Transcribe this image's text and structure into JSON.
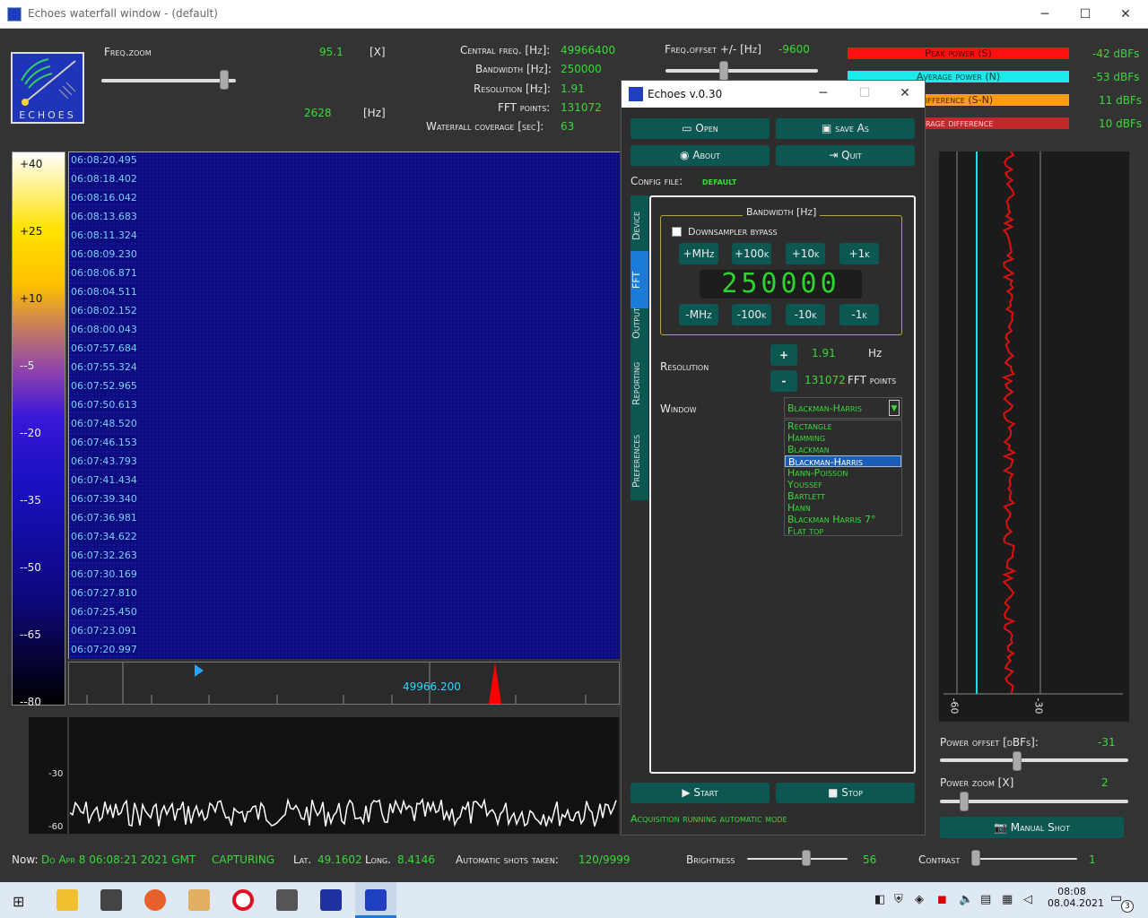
{
  "window": {
    "title": "Echoes waterfall window - (default)"
  },
  "logo": {
    "text": "ECHOES"
  },
  "top": {
    "freq_zoom_label": "Freq.zoom",
    "freq_zoom_value": "95.1",
    "freq_zoom_unit": "[X]",
    "hz_value": "2628",
    "hz_unit": "[Hz]",
    "central_freq_label": "Central freq. [Hz]:",
    "central_freq_value": "49966400",
    "bandwidth_label": "Bandwidth [Hz]:",
    "bandwidth_value": "250000",
    "resolution_label": "Resolution [Hz]:",
    "resolution_value": "1.91",
    "fft_label": "FFT points:",
    "fft_value": "131072",
    "coverage_label": "Waterfall coverage [sec]:",
    "coverage_value": "63",
    "offset_label": "Freq.offset +/- [Hz]",
    "offset_value": "-9600"
  },
  "power": {
    "peak_label": "Peak power (S)",
    "peak_value": "-42 dBFs",
    "peak_color": "#ff1010",
    "avg_label": "Average power (N)",
    "avg_value": "-53 dBFs",
    "avg_color": "#1ce9e9",
    "diff_label": "ifference (S-N)",
    "diff_value": "11 dBFs",
    "diff_color": "#ff9c16",
    "avgdiff_label": "rage difference",
    "avgdiff_value": "10 dBFs",
    "avgdiff_color": "#c0282c"
  },
  "scale": [
    "+40",
    "+25",
    "+10",
    "--5",
    "--20",
    "--35",
    "--50",
    "--65",
    "--80"
  ],
  "timestamps": [
    "06:08:20.495",
    "06:08:18.402",
    "06:08:16.042",
    "06:08:13.683",
    "06:08:11.324",
    "06:08:09.230",
    "06:08:06.871",
    "06:08:04.511",
    "06:08:02.152",
    "06:08:00.043",
    "06:07:57.684",
    "06:07:55.324",
    "06:07:52.965",
    "06:07:50.613",
    "06:07:48.520",
    "06:07:46.153",
    "06:07:43.793",
    "06:07:41.434",
    "06:07:39.340",
    "06:07:36.981",
    "06:07:34.622",
    "06:07:32.263",
    "06:07:30.169",
    "06:07:27.810",
    "06:07:25.450",
    "06:07:23.091",
    "06:07:20.997"
  ],
  "freqaxis": {
    "label": "49966.200"
  },
  "spectrum": {
    "ticks": [
      "-30",
      "-60"
    ]
  },
  "powerpanel": {
    "left_tick": "-60",
    "right_tick": "-30"
  },
  "power_offset": {
    "label": "Power offset [dBFs]:",
    "value": "-31"
  },
  "power_zoom": {
    "label": "Power zoom [X]",
    "value": "2"
  },
  "manual_shot": "Manual Shot",
  "dialog": {
    "title": "Echoes v.0.30",
    "open": "Open",
    "save_as": "save As",
    "about": "About",
    "quit": "Quit",
    "config_label": "Config file:",
    "config_value": "default",
    "tabs": [
      "Device",
      "FFT",
      "Output",
      "Reporting",
      "Preferences"
    ],
    "bandwidth_group": "Bandwidth [Hz]",
    "downsampler": "Downsampler bypass",
    "up_buttons": [
      "+MHz",
      "+100k",
      "+10k",
      "+1k"
    ],
    "down_buttons": [
      "-MHz",
      "-100k",
      "-10k",
      "-1k"
    ],
    "lcd": "250000",
    "resolution_label": "Resolution",
    "plus": "+",
    "minus": "-",
    "res_value": "1.91",
    "res_unit": "Hz",
    "fft_value": "131072",
    "fft_unit": "FFT points",
    "window_label": "Window",
    "window_selected": "Blackman-Harris",
    "window_options": [
      "Rectangle",
      "Hamming",
      "Blackman",
      "Blackman-Harris",
      "Hann-Poisson",
      "Youssef",
      "Bartlett",
      "Hann",
      "Blackman Harris 7°",
      "Flat top"
    ],
    "start": "Start",
    "stop": "Stop",
    "status": "Acquisition running automatic mode"
  },
  "status": {
    "now_label": "Now:",
    "now_value": "Do Apr 8 06:08:21 2021 GMT",
    "capturing": "CAPTURING",
    "lat_label": "Lat.",
    "lat_value": "49.1602",
    "long_label": "Long.",
    "long_value": "8.4146",
    "shots_label": "Automatic shots taken:",
    "shots_value": "120/9999",
    "brightness_label": "Brightness",
    "brightness_value": "56",
    "contrast_label": "Contrast",
    "contrast_value": "1"
  },
  "taskbar": {
    "time": "08:08",
    "date": "08.04.2021",
    "notif": "3"
  }
}
